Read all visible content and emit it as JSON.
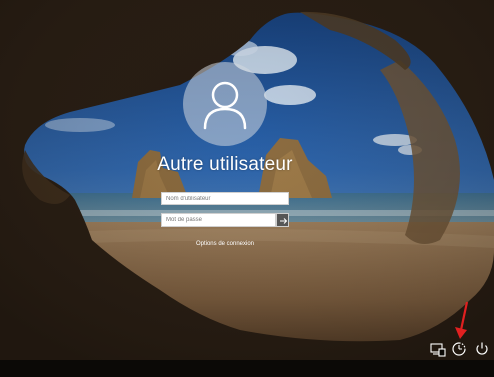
{
  "login": {
    "username": "Autre utilisateur",
    "username_placeholder": "Nom d'utilisateur",
    "password_placeholder": "Mot de passe",
    "sign_in_options": "Options de connexion"
  },
  "icons": {
    "avatar": "user-avatar-icon",
    "submit": "arrow-right-icon",
    "network": "network-icon",
    "ease_of_access": "ease-of-access-icon",
    "power": "power-icon",
    "annotation": "red-arrow"
  },
  "colors": {
    "annotation_arrow": "#e02020",
    "text": "#ffffff",
    "sky": "#2c5fa3",
    "sand": "#8a6a48"
  }
}
